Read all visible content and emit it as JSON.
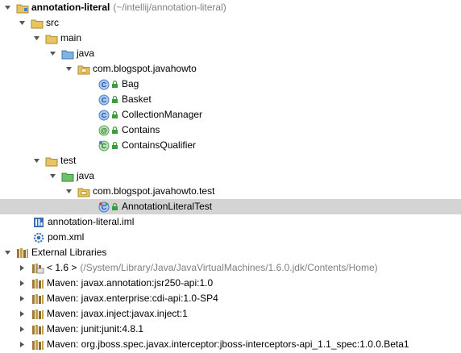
{
  "project": {
    "name": "annotation-literal",
    "path": "(~/intellij/annotation-literal)"
  },
  "nodes": {
    "src": "src",
    "main": "main",
    "java_main": "java",
    "pkg_main": "com.blogspot.javahowto",
    "bag": "Bag",
    "basket": "Basket",
    "collection_manager": "CollectionManager",
    "contains": "Contains",
    "contains_qualifier": "ContainsQualifier",
    "test": "test",
    "java_test": "java",
    "pkg_test": "com.blogspot.javahowto.test",
    "annotation_literal_test": "AnnotationLiteralTest",
    "iml": "annotation-literal.iml",
    "pom": "pom.xml",
    "external_libraries": "External Libraries"
  },
  "jdk": {
    "label": "< 1.6 >",
    "path": "(/System/Library/Java/JavaVirtualMachines/1.6.0.jdk/Contents/Home)"
  },
  "libraries": [
    "Maven: javax.annotation:jsr250-api:1.0",
    "Maven: javax.enterprise:cdi-api:1.0-SP4",
    "Maven: javax.inject:javax.inject:1",
    "Maven: junit:junit:4.8.1",
    "Maven: org.jboss.spec.javax.interceptor:jboss-interceptors-api_1.1_spec:1.0.0.Beta1"
  ],
  "icons": {
    "expanded": "triangle-down-icon",
    "collapsed": "triangle-right-icon",
    "folder": "folder-icon",
    "source_folder": "source-folder-icon",
    "test_folder": "test-folder-icon",
    "package": "package-icon",
    "class": "class-icon",
    "annotation": "annotation-icon",
    "test_class": "test-class-icon",
    "module_file": "module-file-icon",
    "maven_file": "maven-pom-icon",
    "library": "library-icon",
    "jdk": "jdk-icon"
  },
  "colors": {
    "selection": "#d4d4d4",
    "folder": "#e8c463",
    "source_folder": "#7fb3e0",
    "test_folder": "#6cc06a",
    "class_blue": "#4a7fd0",
    "annotation_green": "#4caf50",
    "lock_green": "#3f9b3f",
    "dim_text": "#808080"
  }
}
